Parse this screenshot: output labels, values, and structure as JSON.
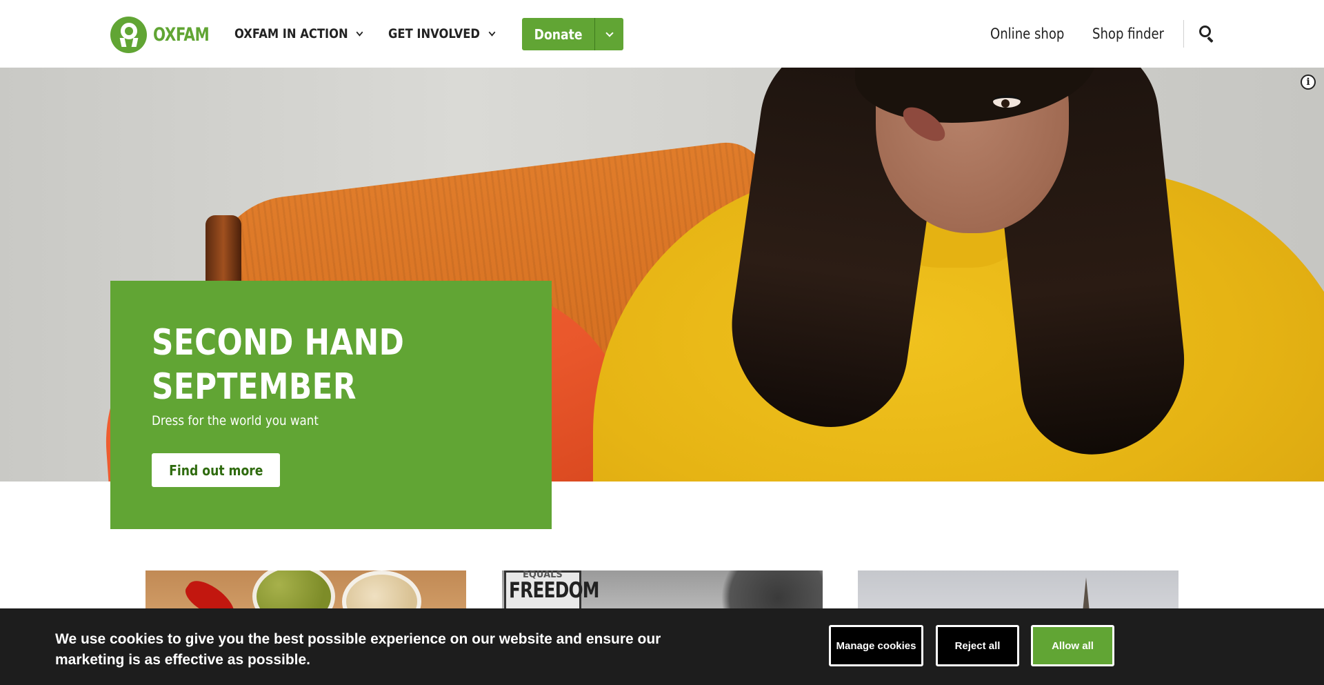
{
  "header": {
    "logo_text": "OXFAM",
    "nav": [
      {
        "label": "OXFAM IN ACTION"
      },
      {
        "label": "GET INVOLVED"
      }
    ],
    "donate_label": "Donate",
    "links": [
      {
        "label": "Online shop"
      },
      {
        "label": "Shop finder"
      }
    ],
    "search_icon": "search-icon"
  },
  "hero": {
    "info_glyph": "i",
    "promo": {
      "title": "SECOND HAND SEPTEMBER",
      "subtitle": "Dress for the world you want",
      "cta_label": "Find out more"
    }
  },
  "cards": [
    {
      "image": "food-olives-chili"
    },
    {
      "image": "protest-sign",
      "sign_top": "EQUALS",
      "sign_main": "FREEDOM"
    },
    {
      "image": "cloudy-skyline"
    }
  ],
  "cookie_banner": {
    "message": "We use cookies to give you the best possible experience on our website and ensure our marketing is as effective as possible.",
    "manage_label": "Manage cookies",
    "reject_label": "Reject all",
    "allow_label": "Allow all"
  },
  "colors": {
    "brand_green": "#61a534",
    "banner_bg": "#1d1d1d",
    "text_dark": "#222222"
  }
}
